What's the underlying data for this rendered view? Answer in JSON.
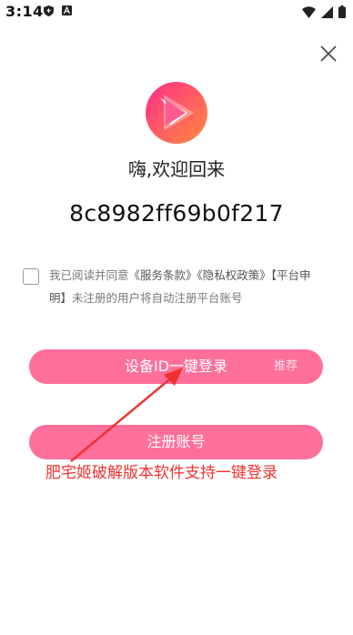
{
  "status_bar": {
    "time": "3:14",
    "left_icons": [
      "shield-icon",
      "a-letter-icon"
    ],
    "right_icons": [
      "wifi-icon",
      "signal-icon",
      "battery-icon"
    ]
  },
  "close_icon": "close-icon",
  "logo_icon": "play-logo-icon",
  "welcome": "嗨,欢迎回来",
  "device_id": "8c8982ff69b0f217",
  "agreement": {
    "prefix": "我已阅读并同意",
    "terms_link": "《服务条款》",
    "privacy_link": "《隐私权政策》",
    "platform_link": "【平台申明】",
    "suffix": "未注册的用户将自动注册平台账号"
  },
  "device_login_button": {
    "label": "设备ID一键登录",
    "badge": "推荐"
  },
  "register_button": {
    "label": "注册账号"
  },
  "promo_text": "肥宅姬破解版本软件支持一键登录",
  "colors": {
    "button": "#ff6f9c",
    "promo": "#f0322f",
    "logo_gradient_start": "#ff2d8a",
    "logo_gradient_end": "#ff8a3d"
  }
}
